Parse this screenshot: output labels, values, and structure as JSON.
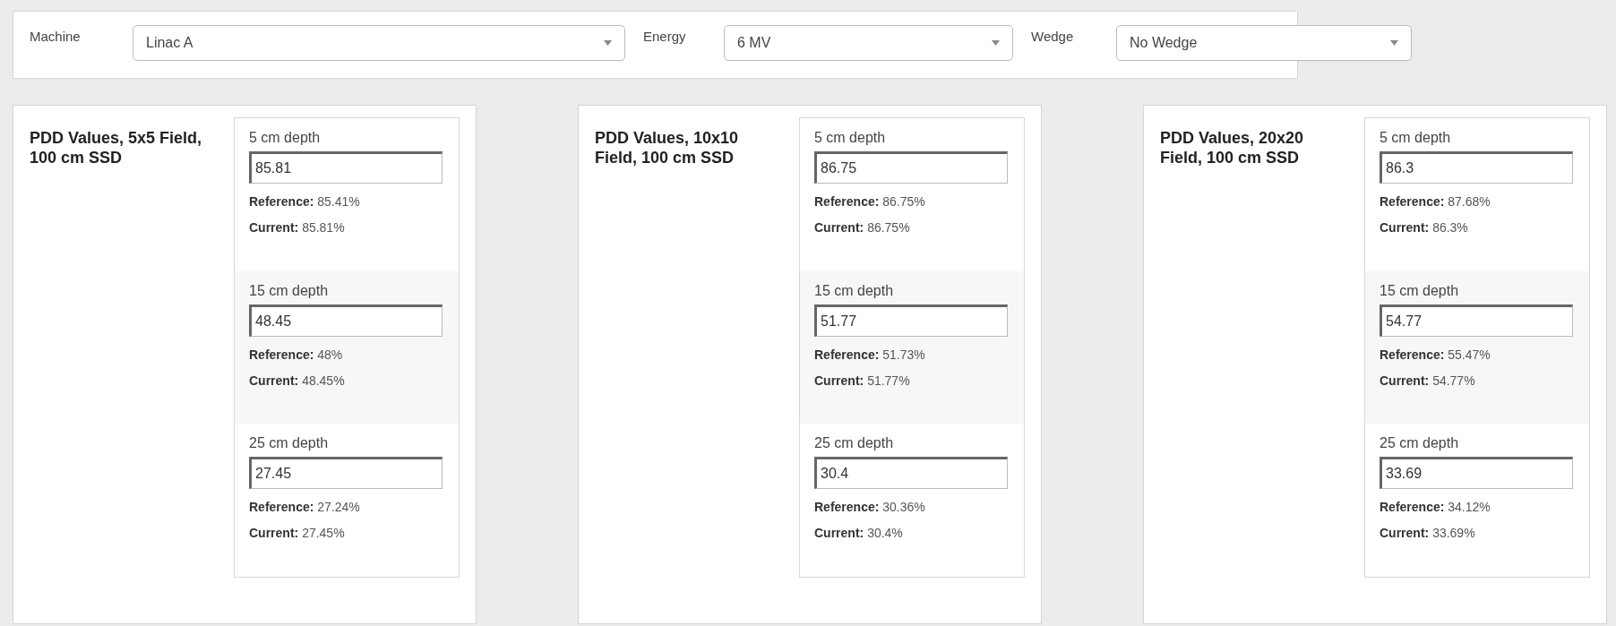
{
  "filters": [
    {
      "label": "Machine",
      "value": "Linac A"
    },
    {
      "label": "Energy",
      "value": "6 MV"
    },
    {
      "label": "Wedge",
      "value": "No Wedge"
    }
  ],
  "panels": [
    {
      "title": "PDD Values, 5x5 Field, 100 cm SSD",
      "depths": [
        {
          "label": "5 cm depth",
          "value": "85.81",
          "reference_label": "Reference:",
          "reference": "85.41%",
          "current_label": "Current:",
          "current": "85.81%"
        },
        {
          "label": "15 cm depth",
          "value": "48.45",
          "reference_label": "Reference:",
          "reference": "48%",
          "current_label": "Current:",
          "current": "48.45%"
        },
        {
          "label": "25 cm depth",
          "value": "27.45",
          "reference_label": "Reference:",
          "reference": "27.24%",
          "current_label": "Current:",
          "current": "27.45%"
        }
      ]
    },
    {
      "title": "PDD Values, 10x10 Field, 100 cm SSD",
      "depths": [
        {
          "label": "5 cm depth",
          "value": "86.75",
          "reference_label": "Reference:",
          "reference": "86.75%",
          "current_label": "Current:",
          "current": "86.75%"
        },
        {
          "label": "15 cm depth",
          "value": "51.77",
          "reference_label": "Reference:",
          "reference": "51.73%",
          "current_label": "Current:",
          "current": "51.77%"
        },
        {
          "label": "25 cm depth",
          "value": "30.4",
          "reference_label": "Reference:",
          "reference": "30.36%",
          "current_label": "Current:",
          "current": "30.4%"
        }
      ]
    },
    {
      "title": "PDD Values, 20x20 Field, 100 cm SSD",
      "depths": [
        {
          "label": "5 cm depth",
          "value": "86.3",
          "reference_label": "Reference:",
          "reference": "87.68%",
          "current_label": "Current:",
          "current": "86.3%"
        },
        {
          "label": "15 cm depth",
          "value": "54.77",
          "reference_label": "Reference:",
          "reference": "55.47%",
          "current_label": "Current:",
          "current": "54.77%"
        },
        {
          "label": "25 cm depth",
          "value": "33.69",
          "reference_label": "Reference:",
          "reference": "34.12%",
          "current_label": "Current:",
          "current": "33.69%"
        }
      ]
    }
  ]
}
